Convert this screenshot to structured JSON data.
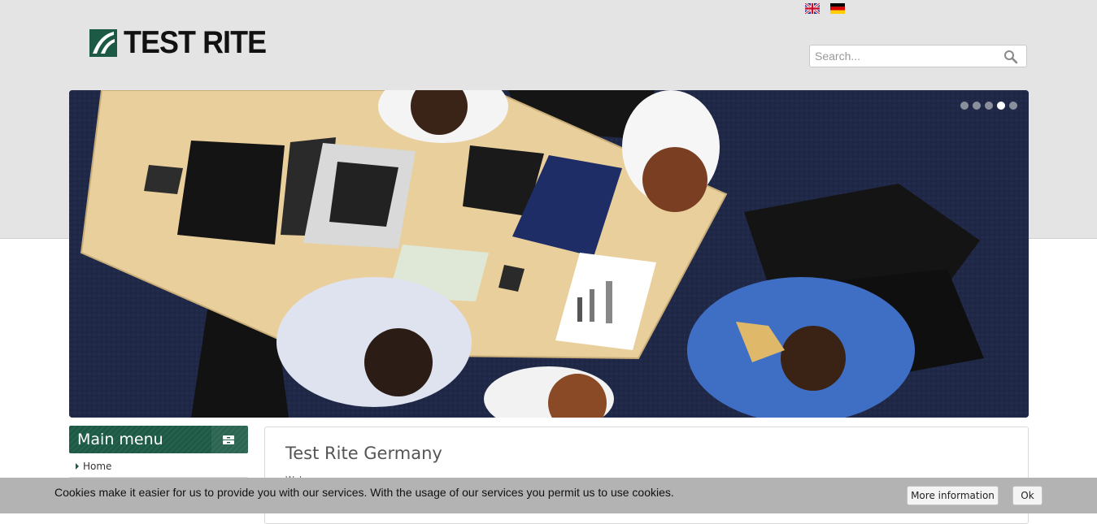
{
  "header": {
    "logo_text": "TEST RITE",
    "languages": [
      {
        "code": "en",
        "icon": "uk-flag-icon"
      },
      {
        "code": "de",
        "icon": "germany-flag-icon"
      }
    ]
  },
  "search": {
    "placeholder": "Search...",
    "value": ""
  },
  "slider": {
    "slide_count": 5,
    "active_index": 3
  },
  "sidebar": {
    "title": "Main menu",
    "items": [
      {
        "label": "Home"
      }
    ]
  },
  "main": {
    "title": "Test Rite Germany",
    "subtitle": "Welcome"
  },
  "cookie_bar": {
    "text": "Cookies make it easier for us to provide you with our services. With the usage of our services you permit us to use cookies.",
    "more_info_label": "More information",
    "ok_label": "Ok"
  },
  "colors": {
    "brand_green": "#1c5a45",
    "header_bg": "#e4e4e4",
    "cookie_bg": "#b3b3b3"
  }
}
